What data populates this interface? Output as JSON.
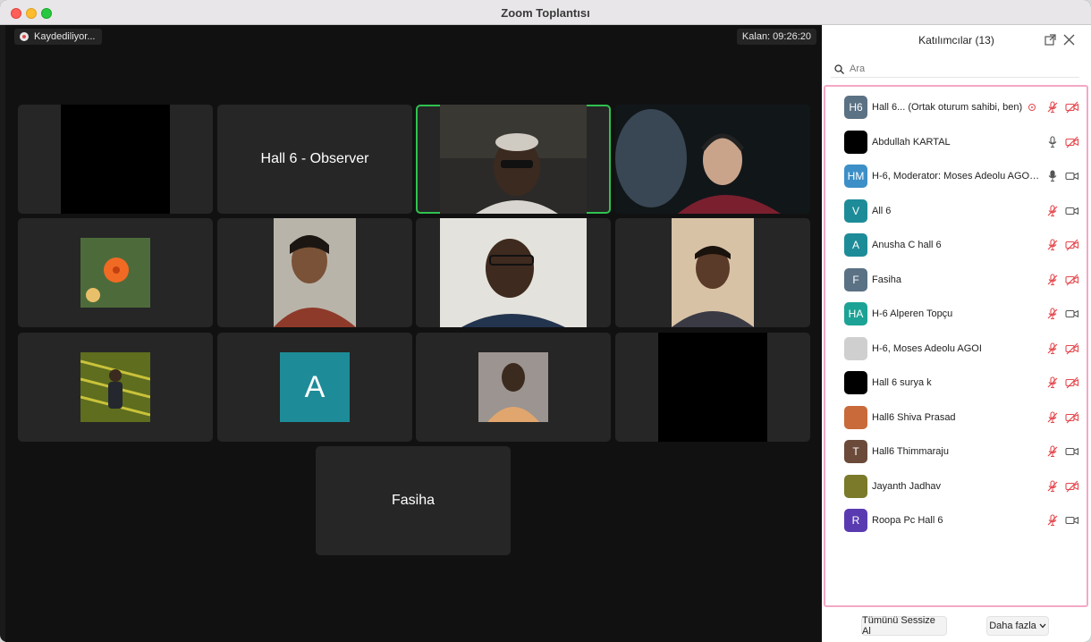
{
  "window": {
    "title": "Zoom Toplantısı"
  },
  "meeting": {
    "recording_label": "Kaydediliyor...",
    "timer_label": "Kalan: 09:26:20"
  },
  "tiles": {
    "observer_name": "Hall 6 - Observer",
    "fasiha_name": "Fasiha",
    "letter_a": "A"
  },
  "panel": {
    "title": "Katılımcılar (13)",
    "search_placeholder": "Ara",
    "mute_all_label": "Tümünü Sessize Al",
    "more_label": "Daha fazla"
  },
  "participants": [
    {
      "initials": "H6",
      "name": "Hall 6... (Ortak oturum sahibi, ben)",
      "color": "#5b7184",
      "mic": "muted",
      "cam": "off",
      "recording": true
    },
    {
      "initials": "",
      "name": "Abdullah KARTAL",
      "color": "#000000",
      "mic": "on",
      "cam": "off"
    },
    {
      "initials": "HM",
      "name": "H-6, Moderator: Moses Adeolu AGOI...",
      "color": "#3d8fc7",
      "mic": "active",
      "cam": "on"
    },
    {
      "initials": "V",
      "name": "All 6",
      "color": "#1d8c98",
      "mic": "muted",
      "cam": "on"
    },
    {
      "initials": "A",
      "name": "Anusha C hall 6",
      "color": "#1d8c98",
      "mic": "muted",
      "cam": "off"
    },
    {
      "initials": "F",
      "name": "Fasiha",
      "color": "#5b7184",
      "mic": "muted",
      "cam": "off"
    },
    {
      "initials": "HA",
      "name": "H-6 Alperen Topçu",
      "color": "#1ca395",
      "mic": "muted",
      "cam": "on"
    },
    {
      "initials": "",
      "name": "H-6, Moses Adeolu AGOI",
      "color": "#cfcfcf",
      "mic": "muted",
      "cam": "off"
    },
    {
      "initials": "",
      "name": "Hall 6 surya k",
      "color": "#000000",
      "mic": "muted",
      "cam": "off"
    },
    {
      "initials": "",
      "name": "Hall6 Shiva Prasad",
      "color": "#c96a3a",
      "mic": "muted",
      "cam": "off"
    },
    {
      "initials": "T",
      "name": "Hall6 Thimmaraju",
      "color": "#6b4a3a",
      "mic": "muted",
      "cam": "on"
    },
    {
      "initials": "",
      "name": "Jayanth Jadhav",
      "color": "#7a7a2a",
      "mic": "muted",
      "cam": "off"
    },
    {
      "initials": "R",
      "name": "Roopa Pc Hall 6",
      "color": "#5a3ab0",
      "mic": "muted",
      "cam": "on"
    }
  ],
  "colors": {
    "accent_active": "#2fc24f",
    "muted": "#e5484d",
    "highlight": "#f4a8c6"
  }
}
